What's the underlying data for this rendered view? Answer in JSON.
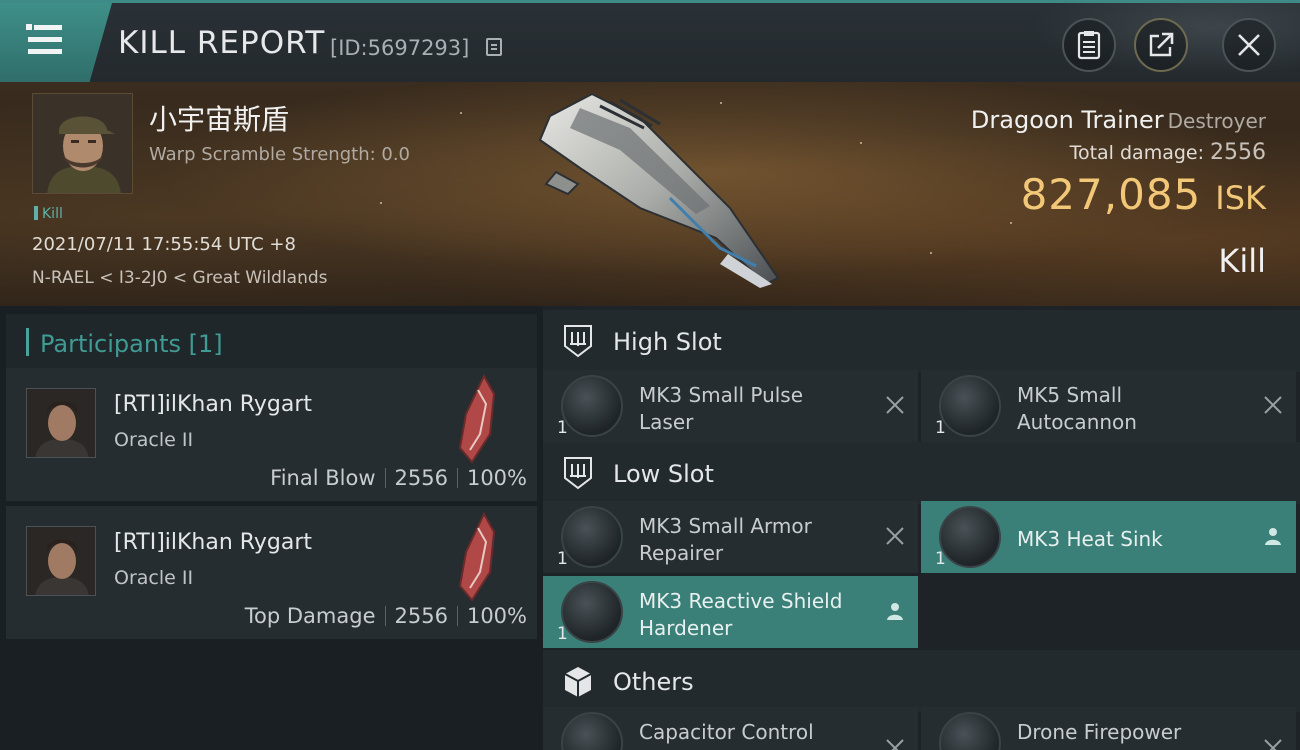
{
  "header": {
    "title": "KILL REPORT",
    "report_id": "[ID:5697293]"
  },
  "victim": {
    "name": "小宇宙斯盾",
    "warp_scramble": "Warp Scramble Strength: 0.0",
    "tag": "Kill",
    "datetime": "2021/07/11 17:55:54 UTC +8",
    "location": "N-RAEL < I3-2J0 < Great Wildlands",
    "ship": "Dragoon Trainer",
    "ship_class": "Destroyer",
    "total_damage_label": "Total damage:",
    "total_damage": "2556",
    "isk_value": "827,085",
    "isk_unit": "ISK",
    "result": "Kill"
  },
  "participants": {
    "label": "Participants [1]",
    "rows": [
      {
        "name": "[RTI]ilKhan Rygart",
        "ship": "Oracle II",
        "role": "Final Blow",
        "damage": "2556",
        "percent": "100%"
      },
      {
        "name": "[RTI]ilKhan Rygart",
        "ship": "Oracle II",
        "role": "Top Damage",
        "damage": "2556",
        "percent": "100%"
      }
    ]
  },
  "fittings": {
    "high_slot": {
      "label": "High Slot",
      "modules": [
        {
          "name_l1": "MK3 Small Pulse",
          "name_l2": "Laser",
          "qty": "1",
          "status": "destroyed"
        },
        {
          "name_l1": "MK5 Small",
          "name_l2": "Autocannon",
          "qty": "1",
          "status": "destroyed"
        }
      ]
    },
    "low_slot": {
      "label": "Low Slot",
      "modules": [
        {
          "name_l1": "MK3 Small Armor",
          "name_l2": "Repairer",
          "qty": "1",
          "status": "destroyed"
        },
        {
          "name_l1": "MK3 Heat Sink",
          "name_l2": "",
          "qty": "1",
          "status": "dropped"
        },
        {
          "name_l1": "MK3 Reactive Shield",
          "name_l2": "Hardener",
          "qty": "1",
          "status": "dropped"
        }
      ]
    },
    "others": {
      "label": "Others",
      "modules": [
        {
          "name_l1": "Capacitor Control",
          "name_l2": "",
          "qty": "",
          "status": "destroyed"
        },
        {
          "name_l1": "Drone Firepower",
          "name_l2": "",
          "qty": "",
          "status": "destroyed"
        }
      ]
    }
  },
  "colors": {
    "accent_teal": "#3f9b93",
    "isk_gold": "#f2c777",
    "fitted_row": "#3a8078"
  }
}
